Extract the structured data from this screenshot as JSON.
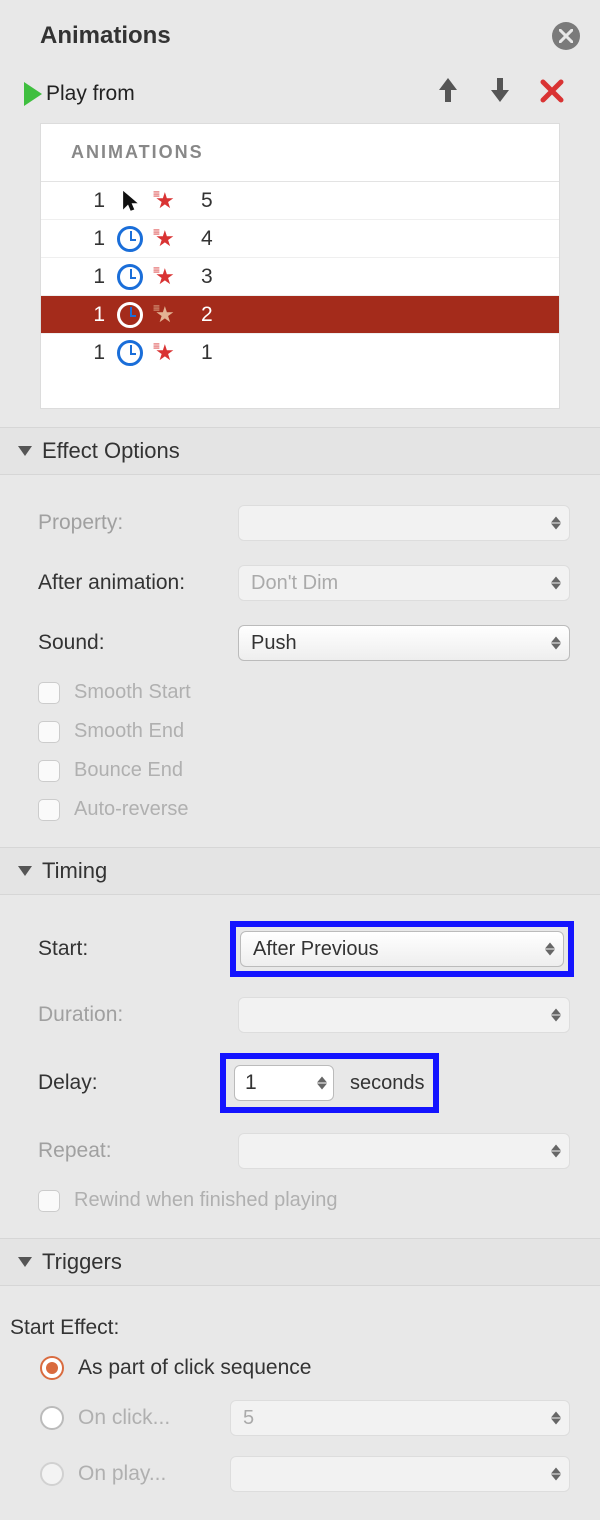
{
  "header": {
    "title": "Animations"
  },
  "toolbar": {
    "play_label": "Play from"
  },
  "list": {
    "header": "ANIMATIONS",
    "items": [
      {
        "order": "1",
        "trigger": "click",
        "label": "5",
        "selected": false
      },
      {
        "order": "1",
        "trigger": "clock",
        "label": "4",
        "selected": false
      },
      {
        "order": "1",
        "trigger": "clock",
        "label": "3",
        "selected": false
      },
      {
        "order": "1",
        "trigger": "clock",
        "label": "2",
        "selected": true
      },
      {
        "order": "1",
        "trigger": "clock",
        "label": "1",
        "selected": false
      }
    ]
  },
  "effect_options": {
    "section_title": "Effect Options",
    "property_label": "Property:",
    "property_value": "",
    "after_anim_label": "After animation:",
    "after_anim_value": "Don't Dim",
    "sound_label": "Sound:",
    "sound_value": "Push",
    "smooth_start": "Smooth Start",
    "smooth_end": "Smooth End",
    "bounce_end": "Bounce End",
    "auto_reverse": "Auto-reverse"
  },
  "timing": {
    "section_title": "Timing",
    "start_label": "Start:",
    "start_value": "After Previous",
    "duration_label": "Duration:",
    "duration_value": "",
    "delay_label": "Delay:",
    "delay_value": "1",
    "delay_unit": "seconds",
    "repeat_label": "Repeat:",
    "repeat_value": "",
    "rewind_label": "Rewind when finished playing"
  },
  "triggers": {
    "section_title": "Triggers",
    "start_effect_label": "Start Effect:",
    "opt_click_seq": "As part of click sequence",
    "opt_on_click": "On click...",
    "opt_on_click_value": "5",
    "opt_on_play": "On play..."
  }
}
